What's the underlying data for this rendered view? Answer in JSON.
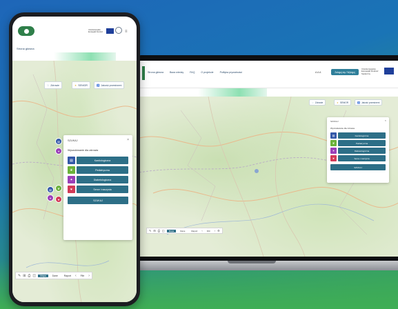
{
  "colors": {
    "primary_button": "#2d6f87",
    "brand_green": "#2f7f4a",
    "accent_mint": "#8de0b2",
    "cat_blue": "#3358a8",
    "cat_green": "#6bb23a",
    "cat_purple": "#9a3fb8",
    "cat_red": "#d23a57"
  },
  "laptop": {
    "nav": [
      "Strona główna",
      "Baza wiedzy",
      "FAQ",
      "O projekcie",
      "Polityka prywatności"
    ],
    "lang": "A A A",
    "login_button": "Zaloguj się / Wyloguj",
    "eu_text": "Unia Europejska Europejski Fundusz Społeczny",
    "chips": [
      {
        "icon": "heart-shield-icon",
        "label": "Zdrowie"
      },
      {
        "icon": "star-icon",
        "label": "SENIOR"
      },
      {
        "icon": "accessibility-icon",
        "label": "Jakość przestrzeni"
      }
    ],
    "panel": {
      "title": "SZUKAJ",
      "close": "×",
      "subtitle": "Wyszukiwanie dla zdrowia",
      "categories": [
        {
          "icon": "clipboard-icon",
          "label": "Kardiologiczna",
          "color": "#3358a8"
        },
        {
          "icon": "leaf-icon",
          "label": "Pediatryczna",
          "color": "#6bb23a"
        },
        {
          "icon": "molecule-icon",
          "label": "Diabetologiczna",
          "color": "#9a3fb8"
        },
        {
          "icon": "heart-icon",
          "label": "Serce i naczynia",
          "color": "#d23a57"
        }
      ],
      "search_button": "SZUKAJ"
    },
    "toolbar": {
      "tabs": [
        "Mapa",
        "Dane",
        "Raport"
      ],
      "active_tab": "Mapa",
      "select": "Filtr"
    }
  },
  "phone": {
    "eu_text": "Unia Europejska Europejski Fundusz",
    "menu": "≡",
    "breadcrumb": "Strona główna",
    "chips": [
      {
        "icon": "heart-shield-icon",
        "label": "Zdrowie"
      },
      {
        "icon": "star-icon",
        "label": "SENIOR"
      },
      {
        "icon": "accessibility-icon",
        "label": "Jakość przestrzeni"
      }
    ],
    "panel": {
      "title": "SZUKAJ",
      "close": "×",
      "subtitle": "Wyszukiwanie dla zdrowia",
      "categories": [
        {
          "icon": "clipboard-icon",
          "label": "Kardiologiczna",
          "color": "#3358a8"
        },
        {
          "icon": "leaf-icon",
          "label": "Pediatryczna",
          "color": "#6bb23a"
        },
        {
          "icon": "molecule-icon",
          "label": "Diabetologiczna",
          "color": "#9a3fb8"
        },
        {
          "icon": "heart-icon",
          "label": "Serce i naczynia",
          "color": "#d23a57"
        }
      ],
      "search_button": "SZUKAJ"
    },
    "toolbar": {
      "tabs": [
        "Mapa",
        "Dane",
        "Raport"
      ],
      "active_tab": "Mapa",
      "select": "Filtr"
    }
  }
}
